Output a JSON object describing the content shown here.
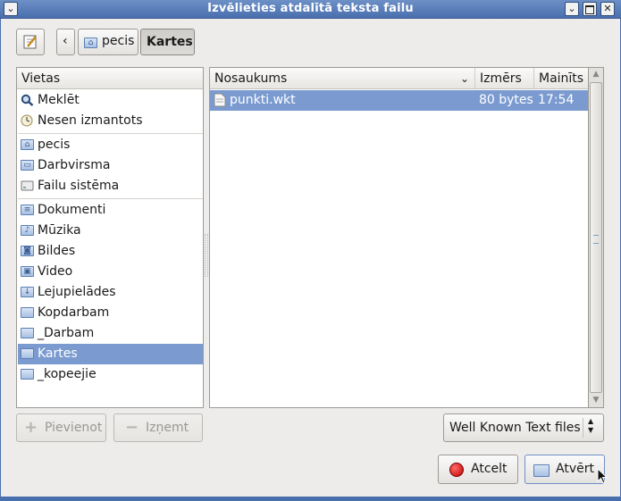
{
  "window": {
    "title": "Izvēlieties atdalītā teksta failu"
  },
  "path": {
    "segments": [
      "pecis",
      "Kartes"
    ]
  },
  "places": {
    "header": "Vietas",
    "items": [
      {
        "label": "Meklēt",
        "icon": "search-icon"
      },
      {
        "label": "Nesen izmantots",
        "icon": "clock-icon"
      },
      {
        "label": "pecis",
        "icon": "home-folder-icon"
      },
      {
        "label": "Darbvirsma",
        "icon": "desktop-folder-icon"
      },
      {
        "label": "Failu sistēma",
        "icon": "drive-icon"
      },
      {
        "label": "Dokumenti",
        "icon": "documents-folder-icon"
      },
      {
        "label": "Mūzika",
        "icon": "music-folder-icon"
      },
      {
        "label": "Bildes",
        "icon": "pictures-folder-icon"
      },
      {
        "label": "Video",
        "icon": "video-folder-icon"
      },
      {
        "label": "Lejupielādes",
        "icon": "downloads-folder-icon"
      },
      {
        "label": "Kopdarbam",
        "icon": "folder-icon"
      },
      {
        "label": "_Darbam",
        "icon": "folder-icon"
      },
      {
        "label": "Kartes",
        "icon": "folder-icon",
        "selected": true
      },
      {
        "label": "_kopeejie",
        "icon": "folder-icon"
      }
    ],
    "add_label": "Pievienot",
    "remove_label": "Izņemt"
  },
  "files": {
    "columns": [
      "Nosaukums",
      "Izmērs",
      "Mainīts"
    ],
    "rows": [
      {
        "name": "punkti.wkt",
        "size": "80 bytes",
        "modified": "17:54",
        "selected": true
      }
    ]
  },
  "filter": {
    "selected": "Well Known Text files"
  },
  "actions": {
    "cancel_label": "Atcelt",
    "open_label": "Atvērt"
  },
  "colors": {
    "selection": "#7b9bd0",
    "titlebar": "#4a6fae"
  }
}
